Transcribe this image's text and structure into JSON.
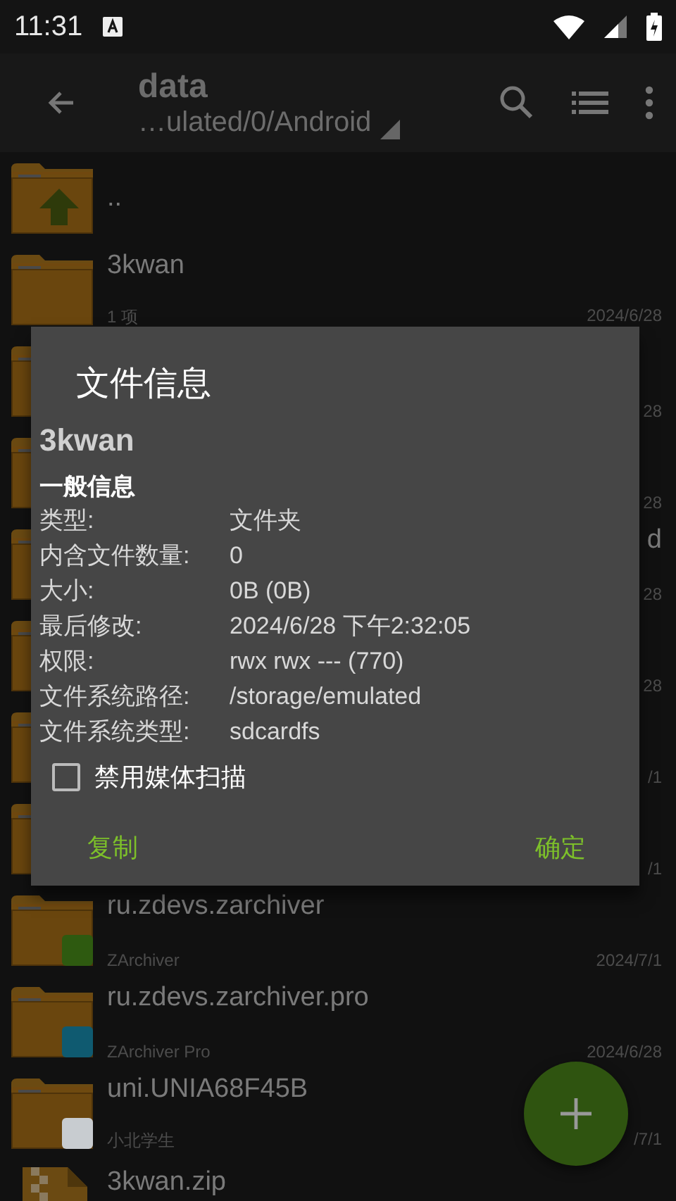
{
  "status_bar": {
    "time": "11:31"
  },
  "toolbar": {
    "title": "data",
    "path": "…ulated/0/Android"
  },
  "rows": [
    {
      "kind": "parent",
      "name": ".."
    },
    {
      "kind": "folder",
      "name": "3kwan",
      "subtitle": "1 项",
      "date": "2024/6/28"
    },
    {
      "kind": "covered",
      "date": "28"
    },
    {
      "kind": "covered",
      "date": "28"
    },
    {
      "kind": "covered",
      "name": "d",
      "date": "28"
    },
    {
      "kind": "covered",
      "date": "28"
    },
    {
      "kind": "covered",
      "date": "/1"
    },
    {
      "kind": "covered",
      "date": "/1"
    },
    {
      "kind": "app_folder",
      "name": "ru.zdevs.zarchiver",
      "subtitle": "ZArchiver",
      "date": "2024/7/1",
      "color": "#2e5a10"
    },
    {
      "kind": "app_folder",
      "name": "ru.zdevs.zarchiver.pro",
      "subtitle": "ZArchiver Pro",
      "date": "2024/6/28",
      "color": "#0f5a70"
    },
    {
      "kind": "app_folder",
      "name": "uni.UNIA68F45B",
      "subtitle": "小北学生",
      "date": "/7/1",
      "color": "#c8ccd0"
    },
    {
      "kind": "archive",
      "name": "3kwan.zip"
    }
  ],
  "dialog": {
    "title": "文件信息",
    "name": "3kwan",
    "section": "一般信息",
    "fields": [
      {
        "label": "类型:",
        "value": "文件夹"
      },
      {
        "label": "内含文件数量:",
        "value": "0"
      },
      {
        "label": "大小:",
        "value": "0B (0B)"
      },
      {
        "label": "最后修改:",
        "value": "2024/6/28 下午2:32:05"
      },
      {
        "label": "权限:",
        "value": "rwx rwx --- (770)"
      },
      {
        "label": "文件系统路径:",
        "value": "/storage/emulated"
      },
      {
        "label": "文件系统类型:",
        "value": "sdcardfs"
      }
    ],
    "checkbox": {
      "label": "禁用媒体扫描",
      "checked": false
    },
    "buttons": [
      "复制",
      "确定"
    ]
  }
}
